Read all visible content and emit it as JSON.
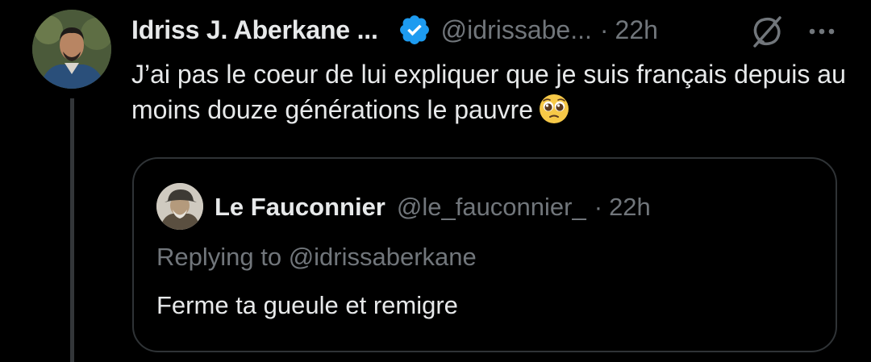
{
  "tweet": {
    "author": {
      "display_name": "Idriss J. Aberkane ...",
      "handle": "@idrissabe...",
      "verified": true,
      "avatar_icon": "profile-photo-man"
    },
    "separator": "·",
    "time": "22h",
    "text": "J’ai pas le coeur de lui expliquer que je suis français depuis au moins douze générations le pauvre",
    "emoji": "pleading-face-emoji",
    "grok_icon": "grok-icon",
    "more_icon": "more-options-icon"
  },
  "quote": {
    "author": {
      "display_name": "Le Fauconnier",
      "handle": "@le_fauconnier_",
      "avatar_icon": "profile-photo-old-man-cap"
    },
    "separator": "·",
    "time": "22h",
    "replying_to": "Replying to @idrissaberkane",
    "text": "Ferme ta gueule et remigre"
  },
  "colors": {
    "background": "#000000",
    "text_primary": "#e7e9ea",
    "text_secondary": "#71767b",
    "verified_blue": "#1d9bf0",
    "border": "#2f3336",
    "thread_line": "#333639"
  }
}
